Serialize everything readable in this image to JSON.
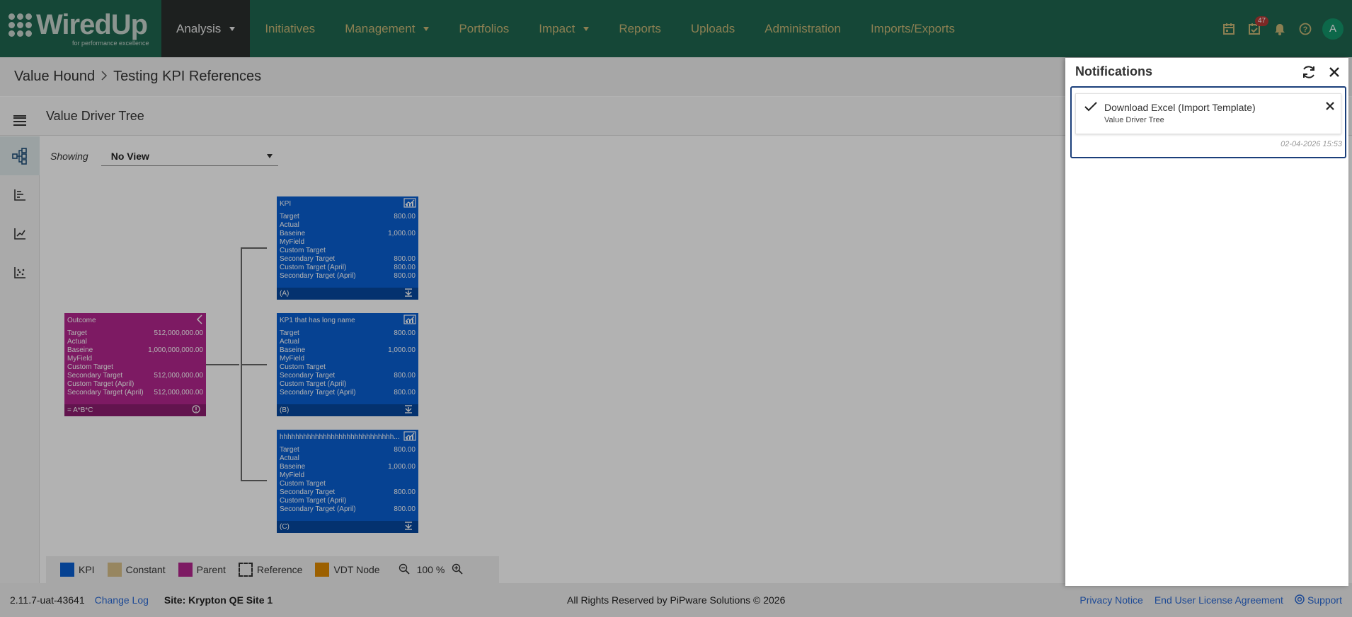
{
  "brand": {
    "name": "WiredUp",
    "tagline": "for performance excellence"
  },
  "nav": {
    "items": [
      {
        "label": "Analysis",
        "active": true,
        "has_caret": true
      },
      {
        "label": "Initiatives"
      },
      {
        "label": "Management",
        "has_caret": true
      },
      {
        "label": "Portfolios"
      },
      {
        "label": "Impact",
        "has_caret": true
      },
      {
        "label": "Reports"
      },
      {
        "label": "Uploads"
      },
      {
        "label": "Administration"
      },
      {
        "label": "Imports/Exports"
      }
    ],
    "tasks_badge": "47",
    "avatar_initial": "A"
  },
  "breadcrumb": {
    "parent": "Value Hound",
    "current": "Testing KPI References"
  },
  "subheader": {
    "title": "Value Driver Tree"
  },
  "view": {
    "label": "Showing",
    "selected": "No View"
  },
  "nodes": {
    "kpi_a": {
      "title": "KPI",
      "footer": "(A)",
      "rows": [
        {
          "label": "Target",
          "value": "800.00"
        },
        {
          "label": "Actual",
          "value": ""
        },
        {
          "label": "Baseine",
          "value": "1,000.00"
        },
        {
          "label": "MyField",
          "value": ""
        },
        {
          "label": "Custom Target",
          "value": ""
        },
        {
          "label": "Secondary Target",
          "value": "800.00"
        },
        {
          "label": "Custom Target (April)",
          "value": "800.00"
        },
        {
          "label": "Secondary Target (April)",
          "value": "800.00"
        }
      ]
    },
    "kpi_b": {
      "title": "KP1 that has long name",
      "footer": "(B)",
      "rows": [
        {
          "label": "Target",
          "value": "800.00"
        },
        {
          "label": "Actual",
          "value": ""
        },
        {
          "label": "Baseine",
          "value": "1,000.00"
        },
        {
          "label": "MyField",
          "value": ""
        },
        {
          "label": "Custom Target",
          "value": ""
        },
        {
          "label": "Secondary Target",
          "value": "800.00"
        },
        {
          "label": "Custom Target (April)",
          "value": ""
        },
        {
          "label": "Secondary Target (April)",
          "value": "800.00"
        }
      ]
    },
    "kpi_c": {
      "title": "hhhhhhhhhhhhhhhhhhhhhhhhhhhhh...",
      "footer": "(C)",
      "rows": [
        {
          "label": "Target",
          "value": "800.00"
        },
        {
          "label": "Actual",
          "value": ""
        },
        {
          "label": "Baseine",
          "value": "1,000.00"
        },
        {
          "label": "MyField",
          "value": ""
        },
        {
          "label": "Custom Target",
          "value": ""
        },
        {
          "label": "Secondary Target",
          "value": "800.00"
        },
        {
          "label": "Custom Target (April)",
          "value": ""
        },
        {
          "label": "Secondary Target (April)",
          "value": "800.00"
        }
      ]
    },
    "outcome": {
      "title": "Outcome",
      "footer": "= A*B*C",
      "rows": [
        {
          "label": "Target",
          "value": "512,000,000.00"
        },
        {
          "label": "Actual",
          "value": ""
        },
        {
          "label": "Baseine",
          "value": "1,000,000,000.00"
        },
        {
          "label": "MyField",
          "value": ""
        },
        {
          "label": "Custom Target",
          "value": ""
        },
        {
          "label": "Secondary Target",
          "value": "512,000,000.00"
        },
        {
          "label": "Custom Target (April)",
          "value": ""
        },
        {
          "label": "Secondary Target (April)",
          "value": "512,000,000.00"
        }
      ]
    }
  },
  "legend": {
    "items": [
      {
        "label": "KPI",
        "color": "#0a5fd2"
      },
      {
        "label": "Constant",
        "color": "#d9c08a"
      },
      {
        "label": "Parent",
        "color": "#b3268e"
      },
      {
        "label": "Reference",
        "color": "dashed"
      },
      {
        "label": "VDT Node",
        "color": "#e08a00"
      }
    ],
    "zoom": "100 %"
  },
  "footer": {
    "version": "2.11.7-uat-43641",
    "change_log": "Change Log",
    "site": "Site: Krypton QE Site 1",
    "rights": "All Rights Reserved by PiPware Solutions © 2026",
    "privacy": "Privacy Notice",
    "eula": "End User License Agreement",
    "support": "Support"
  },
  "notifications": {
    "title": "Notifications",
    "items": [
      {
        "title": "Download Excel (Import Template)",
        "subtitle": "Value Driver Tree",
        "time": "02-04-2026 15:53"
      }
    ]
  },
  "colors": {
    "nav_bg": "#1f6650",
    "nav_text": "#c8b776",
    "kpi": "#0a5fd2",
    "parent": "#b3268e",
    "link": "#2b6bd6"
  }
}
